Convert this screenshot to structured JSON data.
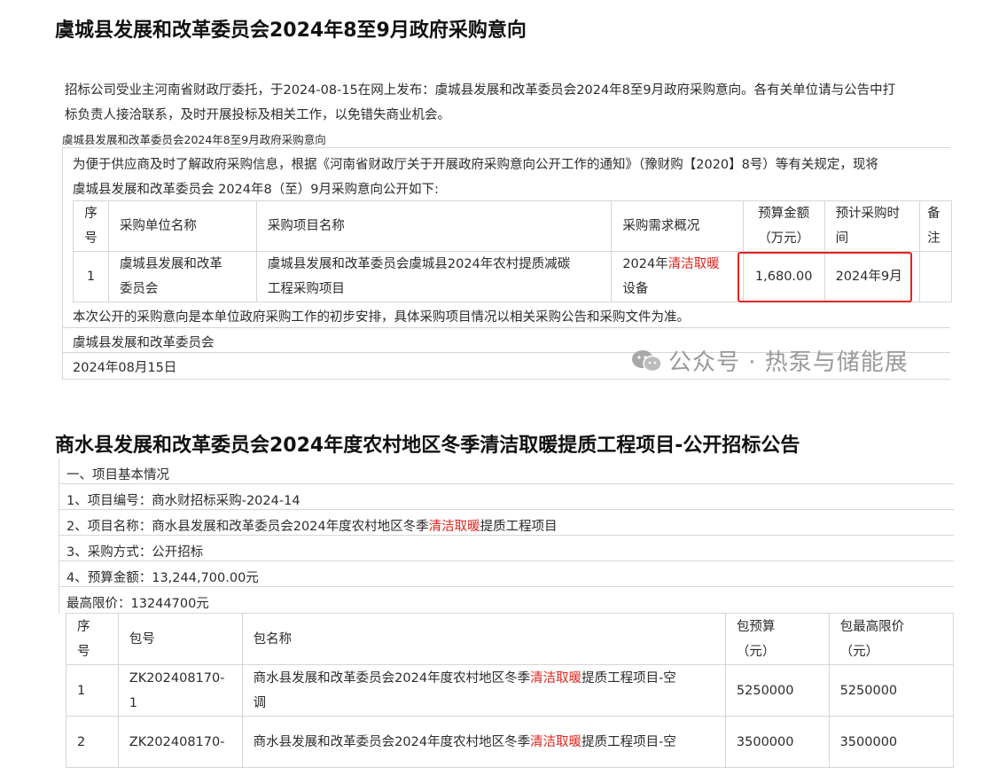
{
  "section1": {
    "title": "虞城县发展和改革委员会2024年8至9月政府采购意向",
    "intro_line1": "招标公司受业主河南省财政厅委托，于2024-08-15在网上发布：虞城县发展和改革委员会2024年8至9月政府采购意向。各有关单位请与公告中打",
    "intro_line2": "标负责人接洽联系，及时开展投标及相关工作，以免错失商业机会。",
    "subtitle": "虞城县发展和改革委员会2024年8至9月政府采购意向",
    "para_line1": "为便于供应商及时了解政府采购信息，根据《河南省财政厅关于开展政府采购意向公开工作的通知》（豫财购【2020】8号）等有关规定，现将",
    "para_line2": "虞城县发展和改革委员会 2024年8（至）9月采购意向公开如下:",
    "headers": {
      "seq_a": "序",
      "seq_b": "号",
      "unit": "采购单位名称",
      "project": "采购项目名称",
      "needs": "采购需求概况",
      "budget_a": "预算金额",
      "budget_b": "（万元）",
      "time_a": "预计采购时",
      "time_b": "间",
      "note_a": "备",
      "note_b": "注"
    },
    "row": {
      "seq": "1",
      "unit_a": "虞城县发展和改革",
      "unit_b": "委员会",
      "project_a": "虞城县发展和改革委员会虞城县2024年农村提质减碳",
      "project_b": "工程采购项目",
      "needs_a1": "2024年",
      "needs_a2": "清洁取暖",
      "needs_b": "设备",
      "budget": "1,680.00",
      "time": "2024年9月",
      "note": ""
    },
    "footer_note": "本次公开的采购意向是本单位政府采购工作的初步安排，具体采购项目情况以相关采购公告和采购文件为准。",
    "footer_org": "虞城县发展和改革委员会",
    "footer_date": "2024年08月15日",
    "watermark": "公众号 · 热泵与储能展"
  },
  "section2": {
    "title": "商水县发展和改革委员会2024年度农村地区冬季清洁取暖提质工程项目-公开招标公告",
    "heading": "一、项目基本情况",
    "item1": "1、项目编号：商水财招标采购-2024-14",
    "item2_a": "2、项目名称：商水县发展和改革委员会2024年度农村地区冬季",
    "item2_b": "清洁取暖",
    "item2_c": "提质工程项目",
    "item3": "3、采购方式：公开招标",
    "item4": "4、预算金额：13,244,700.00元",
    "max_price": "最高限价：13244700元",
    "headers": {
      "seq_a": "序",
      "seq_b": "号",
      "pkg_no": "包号",
      "pkg_name": "包名称",
      "pkg_budget_a": "包预算",
      "pkg_budget_b": "（元）",
      "pkg_max_a": "包最高限价",
      "pkg_max_b": "（元）"
    },
    "rows": [
      {
        "seq": "1",
        "no_a": "ZK202408170-",
        "no_b": "1",
        "name_a": "商水县发展和改革委员会2024年度农村地区冬季",
        "name_red": "清洁取暖",
        "name_c": "提质工程项目-空",
        "name_d": "调",
        "budget": "5250000",
        "max": "5250000"
      },
      {
        "seq": "2",
        "no_a": "ZK202408170-",
        "no_b": "",
        "name_a": "商水县发展和改革委员会2024年度农村地区冬季",
        "name_red": "清洁取暖",
        "name_c": "提质工程项目-空",
        "name_d": "",
        "budget": "3500000",
        "max": "3500000"
      }
    ]
  },
  "colors": {
    "accent_red": "#e0251f",
    "border": "#d6d6d6",
    "watermark": "#9a9a9a"
  }
}
